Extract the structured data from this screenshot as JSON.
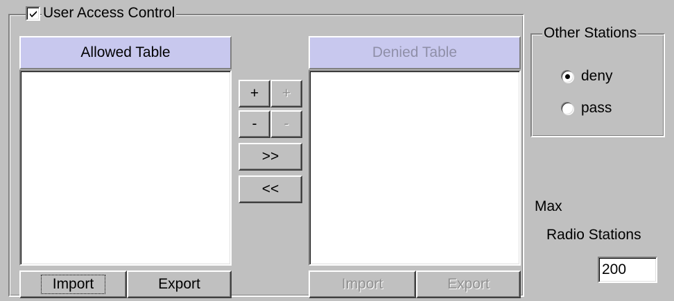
{
  "access_control": {
    "title": "User Access Control",
    "enabled": true
  },
  "allowed_table": {
    "header": "Allowed Table",
    "items": [],
    "import_label": "Import",
    "export_label": "Export"
  },
  "denied_table": {
    "header": "Denied Table",
    "items": [],
    "import_label": "Import",
    "export_label": "Export"
  },
  "transfer_buttons": {
    "add_allowed": "+",
    "add_denied": "+",
    "remove_allowed": "-",
    "remove_denied": "-",
    "move_right": ">>",
    "move_left": "<<"
  },
  "other_stations": {
    "title": "Other Stations",
    "options": [
      {
        "label": "deny",
        "selected": true
      },
      {
        "label": "pass",
        "selected": false
      }
    ]
  },
  "max_stations": {
    "label_line1": "Max",
    "label_line2": "Radio Stations",
    "value": "200"
  },
  "colors": {
    "face": "#c0c0c0",
    "table_header": "#c8c8ee",
    "disabled_text": "#909090"
  }
}
